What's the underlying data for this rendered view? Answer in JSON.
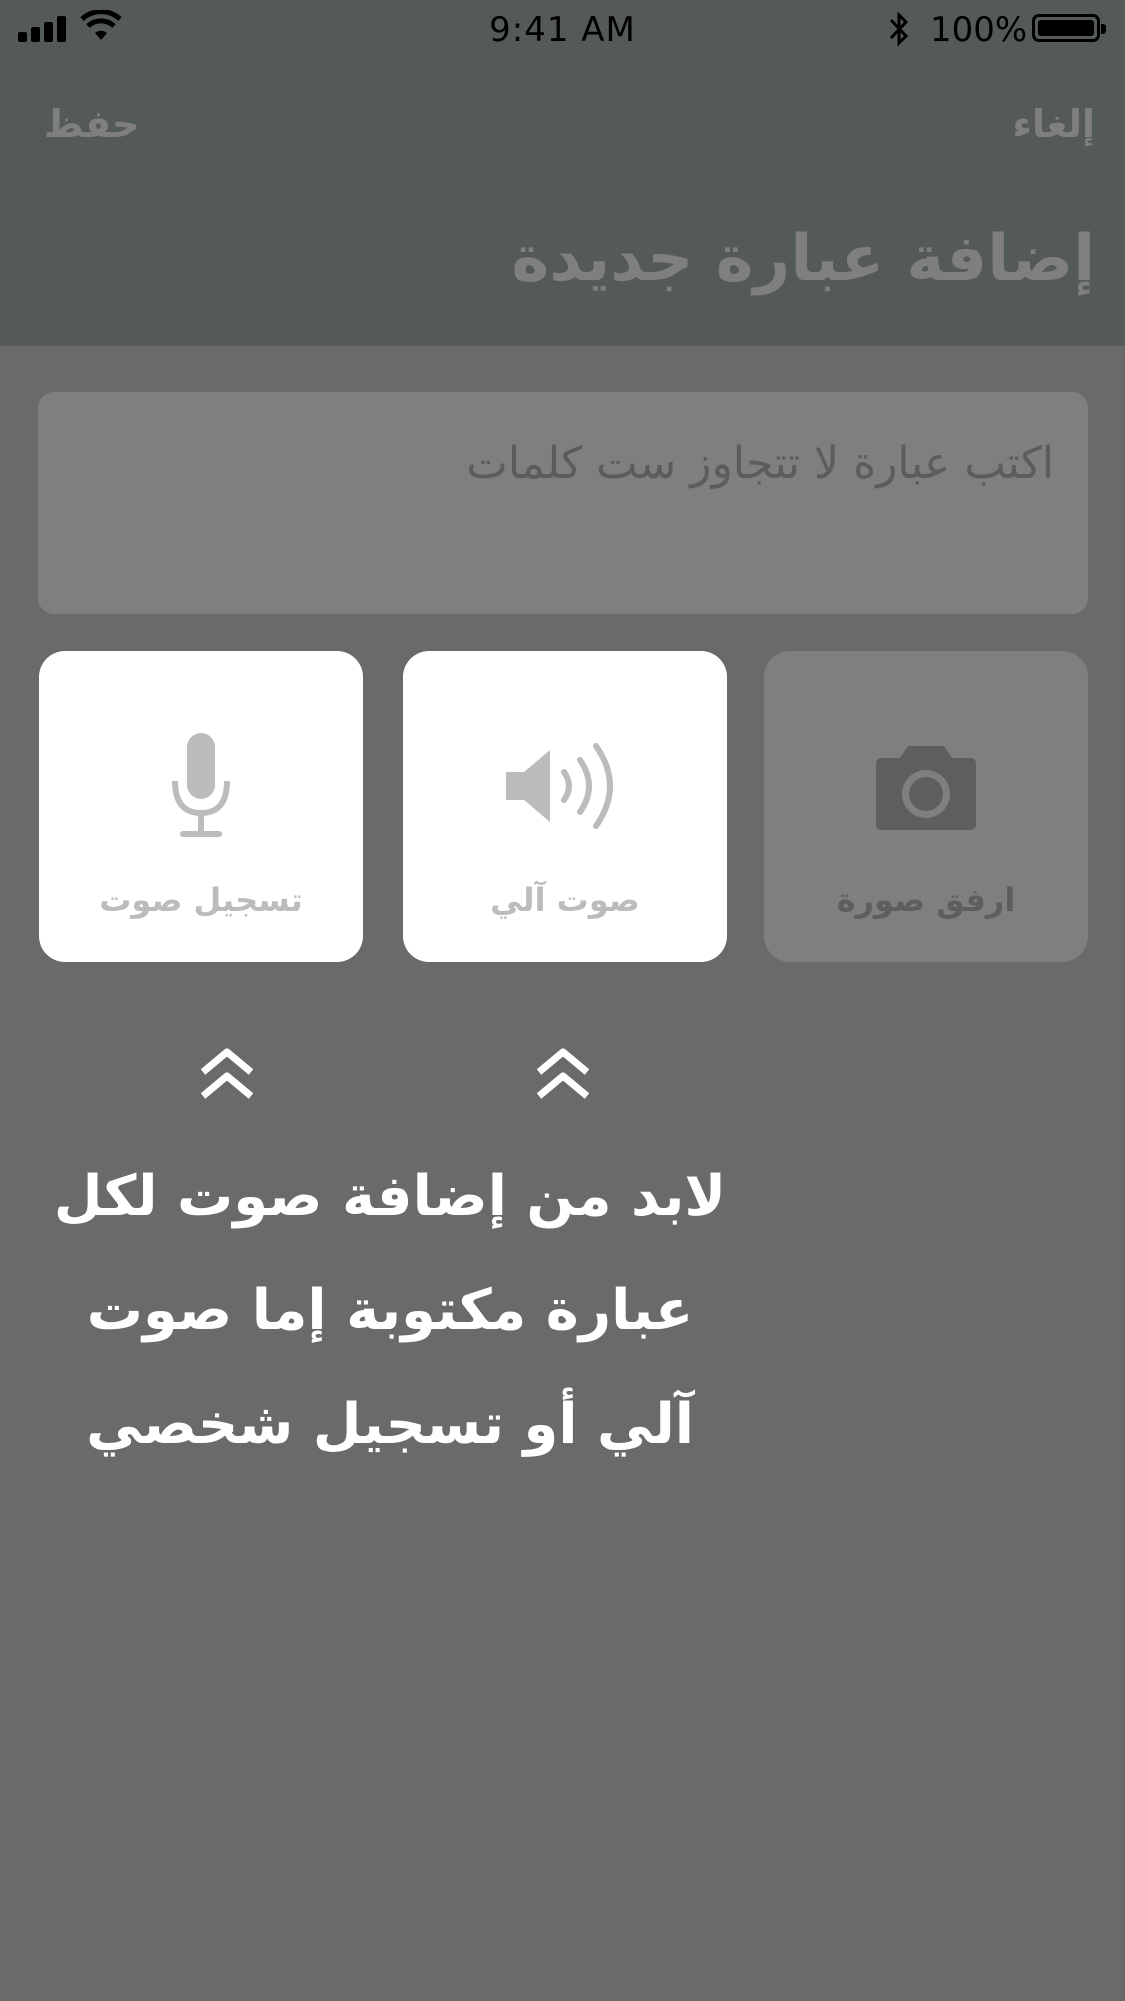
{
  "status_bar": {
    "time": "9:41 AM",
    "battery": "100%",
    "icons": [
      "signal-icon",
      "wifi-icon",
      "bluetooth-icon",
      "battery-icon"
    ]
  },
  "nav": {
    "cancel_label": "إلغاء",
    "save_label": "حفظ",
    "title": "إضافة عبارة جديدة"
  },
  "phrase_input": {
    "placeholder": "اكتب عبارة لا تتجاوز  ست كلمات"
  },
  "attachments": {
    "photo": {
      "label": "ارفق صورة",
      "icon": "camera-icon"
    },
    "auto_voice": {
      "label": "صوت آلي",
      "icon": "speaker-icon"
    },
    "record_voice": {
      "label": "تسجيل صوت",
      "icon": "microphone-icon"
    }
  },
  "hint": {
    "lines": [
      "لابد من إضافة صوت لكل",
      "عبارة مكتوبة إما صوت",
      "آلي أو تسجيل شخصي"
    ],
    "arrow_icon": "double-chevron-up-icon"
  },
  "colors": {
    "header": "#a8b7ae",
    "overlay": "rgba(0,0,0,0.5)",
    "background": "#d4d4d4",
    "icon_gray": "#bcbcbc"
  }
}
